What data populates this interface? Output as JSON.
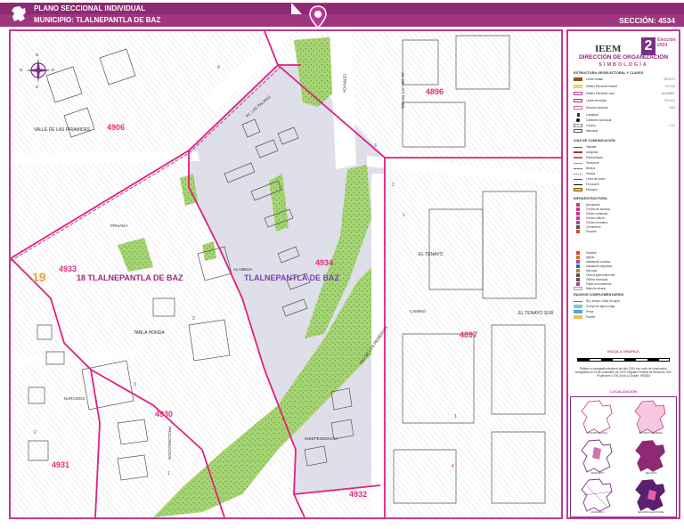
{
  "header": {
    "title": "PLANO SECCIONAL INDIVIDUAL",
    "municipio_label": "MUNICIPIO: TLALNEPANTLA DE BAZ",
    "seccion_label": "SECCIÓN: 4534"
  },
  "colors": {
    "brand_purple": "#8e2a74",
    "brand_magenta": "#c0398f",
    "section_boundary": "#e0207e",
    "selected_section_fill": "#dcdbe8",
    "vegetation": "#9fcf6a",
    "map_background": "#ffffff"
  },
  "compass": {
    "n": "N",
    "s": "S",
    "e": "E",
    "o": "O"
  },
  "map": {
    "sections": [
      {
        "id": "4906",
        "text": "4906"
      },
      {
        "id": "4896",
        "text": "4896"
      },
      {
        "id": "4933",
        "text": "4933"
      },
      {
        "id": "4934",
        "text": "4934"
      },
      {
        "id": "4897",
        "text": "4897"
      },
      {
        "id": "4932",
        "text": "4932"
      },
      {
        "id": "4931",
        "text": "4931"
      },
      {
        "id": "4930",
        "text": "4930"
      }
    ],
    "municipio_left": "18 TLALNEPANTLA DE BAZ",
    "municipio_right": "TLALNEPANTLA DE BAZ",
    "distrito_num": "19",
    "colonias": {
      "valle": "VALLE DE LAS PIRAMIDES",
      "tenayo": "EL TENAYO",
      "tenayo_sur": "EL TENAYO SUR",
      "tabla_honda": "TABLA HONDA"
    },
    "manzanas": [
      "4",
      "1",
      "2",
      "3",
      "4",
      "1",
      "2",
      "3",
      "2",
      "1"
    ],
    "streets": [
      "AV. LAS PALMAS",
      "CERRADA",
      "AV. DE LOS REYES",
      "RIO DE LOS REMEDIOS",
      "CAMINO",
      "PRIVADA",
      "ALAMEDA",
      "INDEPENDENCIA",
      "PROLONGACION",
      "NARCISOS"
    ]
  },
  "legend": {
    "org": "IEEM",
    "number_badge": "2",
    "year": "Elección 2024",
    "direccion": "DIRECCIÓN DE ORGANIZACIÓN",
    "simbologia": "SIMBOLOGÍA",
    "estructura_title": "ESTRUCTURA GEOELECTORAL Y CLAVES",
    "estructura": [
      {
        "label": "Límite estatal",
        "value": "MÉXICO"
      },
      {
        "label": "Distrito Electoral Federal",
        "value": "05 XXA"
      },
      {
        "label": "Distrito Electoral Local",
        "value": "ACAMBAY"
      },
      {
        "label": "Límite municipal",
        "value": "TOLUCA"
      },
      {
        "label": "Sección electoral",
        "value": "1234"
      },
      {
        "label": "Localidad",
        "value": ""
      },
      {
        "label": "Cabecera municipal",
        "value": ""
      },
      {
        "label": "Colonia",
        "value": "LOC"
      },
      {
        "label": "Manzana",
        "value": ""
      }
    ],
    "vias_title": "VÍAS DE COMUNICACIÓN",
    "vias": [
      {
        "label": "Vialidad",
        "value": ""
      },
      {
        "label": "Autopista",
        "value": ""
      },
      {
        "label": "Pavimentada",
        "value": ""
      },
      {
        "label": "Terracería",
        "value": ""
      },
      {
        "label": "Brecha",
        "value": ""
      },
      {
        "label": "Vereda",
        "value": ""
      },
      {
        "label": "Línea de metro",
        "value": ""
      },
      {
        "label": "Ferrocarril",
        "value": ""
      },
      {
        "label": "Mexiquín",
        "value": ""
      }
    ],
    "infra_title": "INFRAESTRUCTURA",
    "infra": [
      "Aeropuerto",
      "Central de autobús",
      "Centro comercial",
      "Centro cultural",
      "Centro recreativo",
      "Cementerio",
      "Escuela",
      "Hospital",
      "Iglesia",
      "Instalación turística",
      "Instalación deportiva",
      "Mercado",
      "Oficina gubernamental",
      "Oficina municipal",
      "Plaza o monumento",
      "Mancha urbana"
    ],
    "rasgos_title": "RASGOS COMPLEMENTARIOS",
    "rasgos": [
      "Río, arroyo o flujo de agua",
      "Cuerpo de agua o lago",
      "Presa",
      "Puente"
    ],
    "escala": "ESCALA GRÁFICA",
    "note": "Editado a cartografía electoral del año 2024 con corte de información cartográfica al 15 de noviembre de 2023. Registro Federal de Electores, INE. Proyección: UTM Zona 14 Datum: WGS84",
    "localizacion": "LOCALIZACIÓN",
    "minimap_captions": [
      "DISTRITO LOCAL",
      "DISTRITO FEDERAL",
      "MUNICIPIO",
      "SECCIÓN",
      "MUNICIPIO",
      "SECCIÓN ELECTORAL"
    ]
  }
}
